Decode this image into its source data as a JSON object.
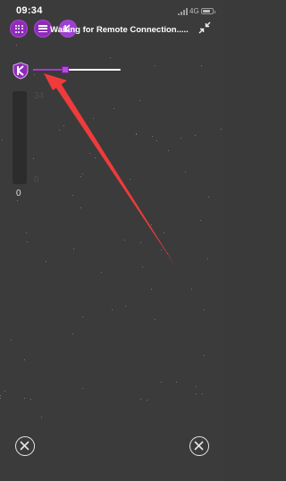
{
  "statusbar": {
    "time": "09:34",
    "network": "4G",
    "battery_level": 0.85
  },
  "toolbar": {
    "connection_status": "Waiting for Remote Connection....."
  },
  "slider": {
    "value_fraction": 0.36
  },
  "meter": {
    "max_label": "34",
    "min_label": "0",
    "value": "0",
    "level_fraction": 0
  },
  "icons": {
    "apps": "grid-icon",
    "menu": "menu-icon",
    "profile": "app-icon",
    "collapse": "collapse-icon",
    "logo": "shield-logo-icon",
    "close_left": "close-icon",
    "close_right": "close-icon"
  },
  "colors": {
    "accent": "#8e2bb8",
    "annotation_arrow": "#ef3b3b",
    "background": "#3b3b3b"
  }
}
